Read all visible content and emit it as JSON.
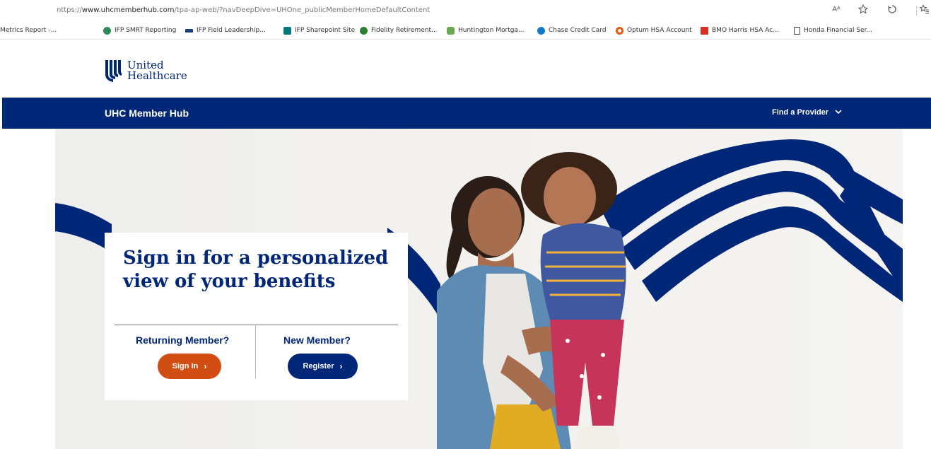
{
  "browser": {
    "url_prefix": "nttps://",
    "url_domain": "www.uhcmemberhub.com",
    "url_rest": "/tpa-ap-web/?navDeepDive=UHOne_publicMemberHomeDefaultContent",
    "read_aloud_label": "Aᴬ",
    "icons": [
      "read-aloud-icon",
      "favorite-icon",
      "extensions-icon",
      "favorites-bar-icon"
    ]
  },
  "bookmarks": [
    {
      "label": "Metrics Report -...",
      "color": "#666666"
    },
    {
      "label": "IFP SMRT Reporting",
      "color": "#2e8b57"
    },
    {
      "label": "IFP Field Leadership...",
      "color": "#1f3f7a"
    },
    {
      "label": "IFP Sharepoint Site",
      "color": "#03787c"
    },
    {
      "label": "Fidelity Retirement...",
      "color": "#2e7d32"
    },
    {
      "label": "Huntington Mortga...",
      "color": "#6aa84f"
    },
    {
      "label": "Chase Credit Card",
      "color": "#117aca"
    },
    {
      "label": "Optum HSA Account",
      "color": "#e8590c"
    },
    {
      "label": "BMO Harris HSA Ac...",
      "color": "#0079c1"
    },
    {
      "label": "Honda Financial Ser...",
      "color": "#ffffff"
    }
  ],
  "brand": {
    "line1": "United",
    "line2": "Healthcare"
  },
  "nav": {
    "title": "UHC Member Hub",
    "find_provider": "Find a Provider",
    "chevron": "⌄"
  },
  "hero": {
    "heading": "Sign in for a personalized view of your benefits",
    "returning_label": "Returning Member?",
    "signin_label": "Sign In",
    "new_label": "New Member?",
    "register_label": "Register",
    "arrow": "›"
  },
  "colors": {
    "brand_blue": "#002677",
    "signin_orange": "#d14d14"
  }
}
